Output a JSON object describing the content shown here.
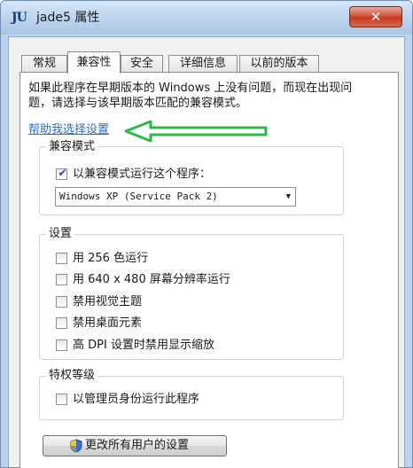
{
  "window": {
    "app_icon_text": "JU",
    "title": "jade5 属性",
    "close_glyph": "✕"
  },
  "tabs": [
    {
      "label": "常规",
      "active": false
    },
    {
      "label": "兼容性",
      "active": true
    },
    {
      "label": "安全",
      "active": false
    },
    {
      "label": "详细信息",
      "active": false
    },
    {
      "label": "以前的版本",
      "active": false
    }
  ],
  "compat": {
    "description": "如果此程序在早期版本的 Windows 上没有问题，而现在出现问题，请选择与该早期版本匹配的兼容模式。",
    "help_link": "帮助我选择设置",
    "mode_group": {
      "label": "兼容模式",
      "checkbox": {
        "label": "以兼容模式运行这个程序：",
        "checked": true
      },
      "select_value": "Windows XP (Service Pack 2)"
    },
    "settings_group": {
      "label": "设置",
      "items": [
        {
          "label": "用 256 色运行",
          "checked": false
        },
        {
          "label": "用 640 x 480 屏幕分辨率运行",
          "checked": false
        },
        {
          "label": "禁用视觉主题",
          "checked": false
        },
        {
          "label": "禁用桌面元素",
          "checked": false
        },
        {
          "label": "高 DPI 设置时禁用显示缩放",
          "checked": false
        }
      ]
    },
    "privilege_group": {
      "label": "特权等级",
      "checkbox": {
        "label": "以管理员身份运行此程序",
        "checked": false
      }
    },
    "all_users_button": "更改所有用户的设置"
  },
  "icons": {
    "check_glyph": "✔",
    "dropdown_glyph": "▼",
    "annotation_arrow": "green-arrow-icon",
    "shield": "uac-shield-icon"
  },
  "colors": {
    "link": "#2e6fb5",
    "arrow": "#2fb84a",
    "close_button": "#c23a24"
  }
}
